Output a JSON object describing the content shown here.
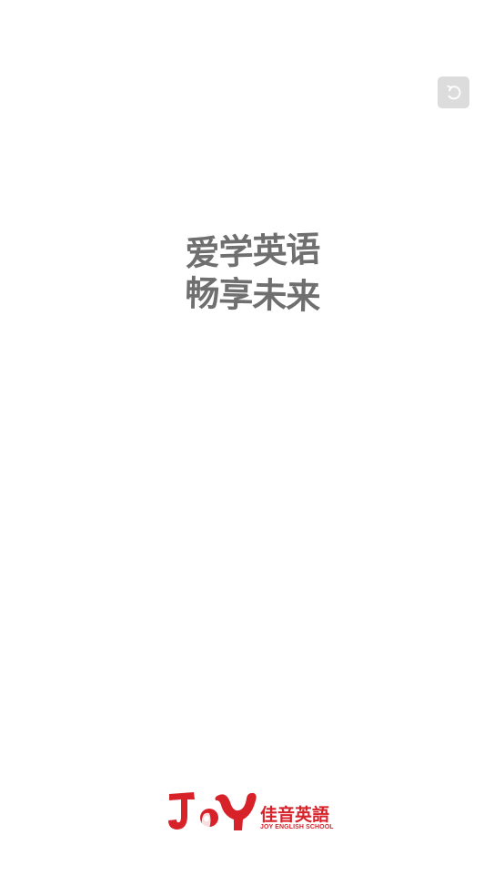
{
  "splash": {
    "slogan_line1": "爱学英语",
    "slogan_line2": "畅享未来"
  },
  "skip_button": {
    "icon": "refresh-icon"
  },
  "brand": {
    "name_cn": "佳音英語",
    "name_en": "JOY ENGLISH SCHOOL",
    "logo_text": "JOY",
    "color": "#d8222a"
  },
  "colors": {
    "background": "#ffffff",
    "slogan": "#6f6f6f",
    "skip_button_bg": "#dcdcdc"
  }
}
